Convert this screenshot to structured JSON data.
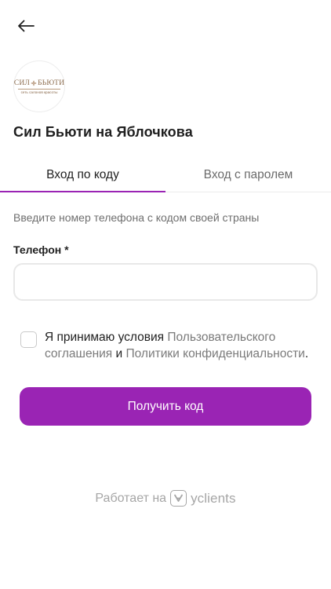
{
  "header": {
    "back_icon": "arrow-left-icon"
  },
  "salon": {
    "logo": {
      "brand_left": "СИЛ",
      "brand_right": "БЬЮТИ",
      "tagline": "сеть салонов красоты",
      "color": "#8a6a4c"
    },
    "name": "Сил Бьюти на Яблочкова"
  },
  "tabs": [
    {
      "label": "Вход по коду",
      "active": true
    },
    {
      "label": "Вход с паролем",
      "active": false
    }
  ],
  "form": {
    "hint": "Введите номер телефона с кодом своей страны",
    "phone_label": "Телефон *",
    "phone_value": "",
    "phone_placeholder": "",
    "consent": {
      "checked": false,
      "prefix": "Я принимаю условия ",
      "link_agreement": "Пользовательского соглашения",
      "middle": " и ",
      "link_privacy": "Политики конфиденциальности",
      "suffix": "."
    },
    "submit_label": "Получить код"
  },
  "footer": {
    "powered_text": "Работает на",
    "brand": "yclients",
    "brand_icon": "yclients-logo-icon"
  },
  "colors": {
    "accent": "#9a24b4",
    "muted_text": "#6f6f6f",
    "border": "#e8e8e8"
  }
}
